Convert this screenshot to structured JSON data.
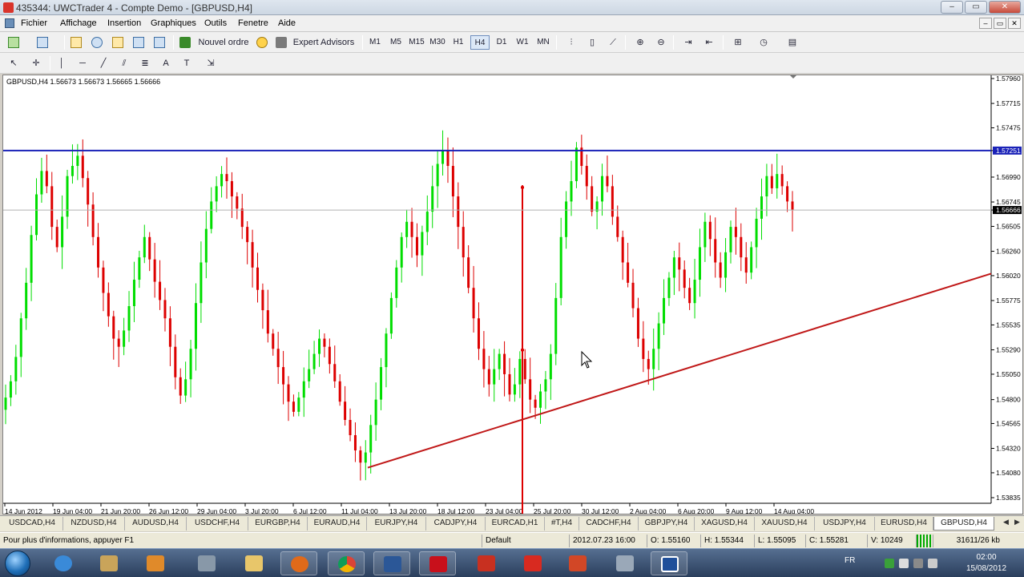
{
  "window": {
    "title": "435344: UWCTrader 4 - Compte Demo - [GBPUSD,H4]",
    "controls": {
      "minimize": "–",
      "restore": "▭",
      "close": "✕"
    }
  },
  "menu": [
    "Fichier",
    "Affichage",
    "Insertion",
    "Graphiques",
    "Outils",
    "Fenetre",
    "Aide"
  ],
  "toolbar": {
    "new_order_label": "Nouvel ordre",
    "expert_advisors_label": "Expert Advisors",
    "timeframes": [
      "M1",
      "M5",
      "M15",
      "M30",
      "H1",
      "H4",
      "D1",
      "W1",
      "MN"
    ],
    "active_timeframe": "H4"
  },
  "chart": {
    "header": "GBPUSD,H4  1.56673 1.56673 1.56665 1.56666",
    "price_labels": [
      "1.57960",
      "1.57715",
      "1.57475",
      "1.57251",
      "1.56990",
      "1.56745",
      "1.56666",
      "1.56505",
      "1.56260",
      "1.56020",
      "1.55775",
      "1.55535",
      "1.55290",
      "1.55050",
      "1.54800",
      "1.54565",
      "1.54320",
      "1.54080",
      "1.53835"
    ],
    "highlight_resistance": "1.57251",
    "highlight_current": "1.56666",
    "time_labels": [
      "14 Jun 2012",
      "19 Jun 04:00",
      "21 Jun 20:00",
      "26 Jun 12:00",
      "29 Jun 04:00",
      "3 Jul 20:00",
      "6 Jul 12:00",
      "11 Jul 04:00",
      "13 Jul 20:00",
      "18 Jul 12:00",
      "23 Jul 04:00",
      "25 Jul 20:00",
      "30 Jul 12:00",
      "2 Aug 04:00",
      "6 Aug 20:00",
      "9 Aug 12:00",
      "14 Aug 04:00"
    ],
    "colors": {
      "bull": "#00dd00",
      "bear": "#dd0000",
      "resistance": "#1a22b8",
      "trendline": "#c01818",
      "bid_line": "#b0b0b0"
    }
  },
  "chart_data": {
    "type": "candlestick",
    "symbol": "GBPUSD",
    "timeframe": "H4",
    "ylim": [
      1.53835,
      1.5796
    ],
    "x_start": "14 Jun 2012",
    "x_end": "14 Aug 04:00",
    "resistance_level": 1.57251,
    "current_price": 1.56666,
    "support_trendline": {
      "from_price": 1.5413,
      "to_price": 1.5604
    },
    "closes": [
      1.5482,
      1.5498,
      1.5522,
      1.556,
      1.5595,
      1.5642,
      1.5682,
      1.5705,
      1.569,
      1.565,
      1.563,
      1.566,
      1.57,
      1.571,
      1.572,
      1.5698,
      1.5672,
      1.564,
      1.561,
      1.5585,
      1.5562,
      1.554,
      1.5532,
      1.5548,
      1.5572,
      1.5598,
      1.562,
      1.564,
      1.5618,
      1.5596,
      1.5578,
      1.556,
      1.5532,
      1.5502,
      1.5484,
      1.55,
      1.553,
      1.5575,
      1.5615,
      1.5648,
      1.5675,
      1.569,
      1.5702,
      1.5695,
      1.568,
      1.5668,
      1.565,
      1.5635,
      1.561,
      1.5588,
      1.5568,
      1.5545,
      1.553,
      1.5512,
      1.5495,
      1.5478,
      1.5468,
      1.5482,
      1.5498,
      1.551,
      1.5525,
      1.554,
      1.5532,
      1.5515,
      1.5498,
      1.5478,
      1.546,
      1.5445,
      1.543,
      1.5418,
      1.5428,
      1.5455,
      1.548,
      1.5512,
      1.5545,
      1.558,
      1.561,
      1.564,
      1.5655,
      1.564,
      1.5622,
      1.5645,
      1.5665,
      1.569,
      1.5712,
      1.5725,
      1.571,
      1.568,
      1.565,
      1.562,
      1.559,
      1.556,
      1.553,
      1.551,
      1.5495,
      1.551,
      1.5525,
      1.5505,
      1.5485,
      1.5495,
      1.552,
      1.55,
      1.548,
      1.5472,
      1.5488,
      1.55,
      1.5525,
      1.558,
      1.564,
      1.5675,
      1.5695,
      1.5728,
      1.571,
      1.569,
      1.5665,
      1.5675,
      1.57,
      1.569,
      1.566,
      1.564,
      1.5615,
      1.5595,
      1.557,
      1.554,
      1.552,
      1.551,
      1.553,
      1.5555,
      1.558,
      1.56,
      1.562,
      1.5608,
      1.559,
      1.5575,
      1.5598,
      1.563,
      1.5655,
      1.5638,
      1.5615,
      1.56,
      1.5625,
      1.565,
      1.564,
      1.562,
      1.5605,
      1.563,
      1.5658,
      1.568,
      1.57,
      1.5688,
      1.5702,
      1.569,
      1.5675,
      1.5667
    ]
  },
  "symbol_tabs": [
    "USDCAD,H4",
    "NZDUSD,H4",
    "AUDUSD,H4",
    "USDCHF,H4",
    "EURGBP,H4",
    "EURAUD,H4",
    "EURJPY,H4",
    "CADJPY,H4",
    "EURCAD,H1",
    "#T,H4",
    "CADCHF,H4",
    "GBPJPY,H4",
    "XAGUSD,H4",
    "XAUUSD,H4",
    "USDJPY,H4",
    "EURUSD,H4",
    "GBPUSD,H4"
  ],
  "active_symbol_tab": "GBPUSD,H4",
  "status": {
    "help": "Pour plus d'informations, appuyer F1",
    "profile": "Default",
    "datetime": "2012.07.23 16:00",
    "open": "O: 1.55160",
    "high": "H: 1.55344",
    "low": "L: 1.55095",
    "close": "C: 1.55281",
    "volume": "V: 10249",
    "traffic": "31611/26 kb"
  },
  "taskbar": {
    "lang": "FR",
    "time": "02:00",
    "date": "15/08/2012"
  }
}
